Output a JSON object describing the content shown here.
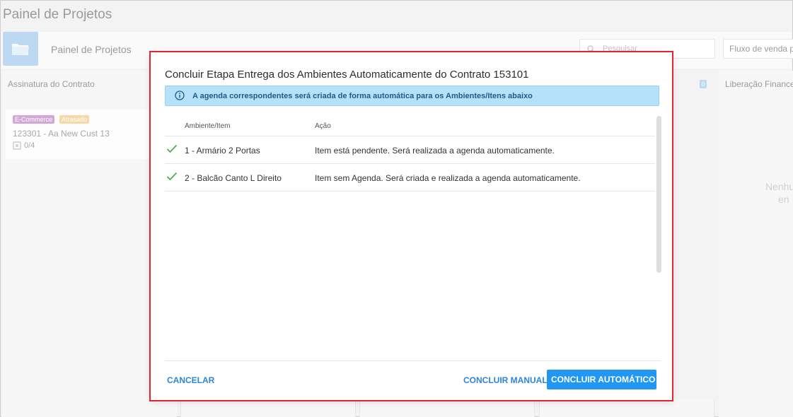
{
  "app": {
    "page_title": "Painel de Projetos",
    "toolbar_title": "Painel de Projetos",
    "search_placeholder": "Pesquisar",
    "fluxo_label": "Fluxo de venda pa",
    "count_badge": "0",
    "icon_folder": "folder-icon",
    "icon_search": "search-icon"
  },
  "columns": [
    {
      "title": "Assinatura do Contrato",
      "card": {
        "badges": [
          "E-Commerce",
          "Atrasado"
        ],
        "name": "123301 - Aa New Cust 13",
        "progress": "0/4"
      }
    },
    {
      "title": "Liberação Financeira",
      "empty_line1": "Nenhu",
      "empty_line2": "en"
    }
  ],
  "modal": {
    "title": "Concluir Etapa Entrega dos Ambientes Automaticamente do Contrato 153101",
    "info_text": "A agenda correspondentes será criada de forma automática para os Ambientes/Itens abaixo",
    "table": {
      "headers": [
        "Ambiente/Item",
        "Ação"
      ],
      "rows": [
        {
          "item": "1 - Armário 2 Portas",
          "acao": "Item está pendente. Será realizada a agenda automaticamente."
        },
        {
          "item": "2 - Balcão Canto L Direito",
          "acao": "Item sem Agenda. Será criada e realizada a agenda automaticamente."
        }
      ]
    },
    "buttons": {
      "cancel": "CANCELAR",
      "manual": "CONCLUIR MANUAL",
      "auto": "CONCLUIR AUTOMÁTICO"
    }
  },
  "colors": {
    "accent": "#2196f3",
    "highlight": "#e32530",
    "info_bg": "#b6e1fa",
    "check": "#4caf50"
  }
}
